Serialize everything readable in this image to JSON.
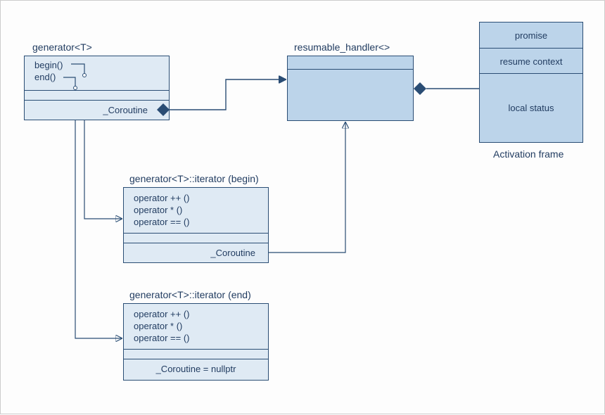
{
  "generator": {
    "title": "generator<T>",
    "methods": [
      "begin()",
      "end()"
    ],
    "field": "_Coroutine"
  },
  "handler": {
    "title": "resumable_handler<>"
  },
  "iterator_begin": {
    "title": "generator<T>::iterator (begin)",
    "methods": [
      "operator ++ ()",
      "operator * ()",
      "operator == ()"
    ],
    "field": "_Coroutine"
  },
  "iterator_end": {
    "title": "generator<T>::iterator (end)",
    "methods": [
      "operator ++ ()",
      "operator * ()",
      "operator == ()"
    ],
    "field": "_Coroutine = nullptr"
  },
  "activation_frame": {
    "rows": [
      "promise",
      "resume context",
      "local status"
    ],
    "caption": "Activation frame"
  },
  "colors": {
    "box_fill": "#dfeaf4",
    "box_mid": "#bcd4ea",
    "stroke": "#2a4d74"
  }
}
